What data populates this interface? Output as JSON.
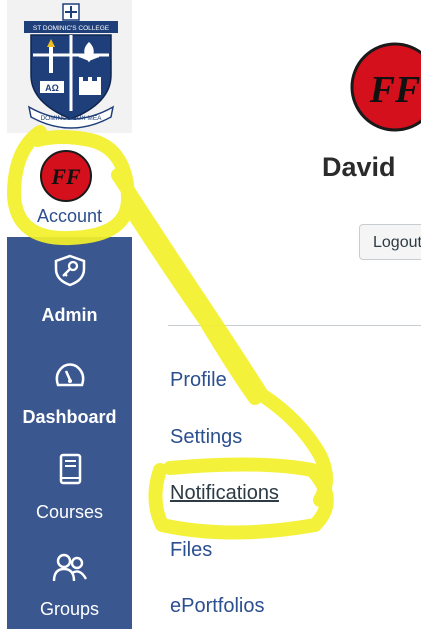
{
  "school": {
    "name": "ST DOMINIC'S COLLEGE",
    "motto": "DOMINUS LUX MEA",
    "initials": "AΩ"
  },
  "user": {
    "name": "David",
    "avatar_initials": "FF"
  },
  "sidebar": {
    "items": [
      {
        "label": "Account",
        "icon": "avatar-icon"
      },
      {
        "label": "Admin",
        "icon": "shield-key-icon"
      },
      {
        "label": "Dashboard",
        "icon": "speedometer-icon"
      },
      {
        "label": "Courses",
        "icon": "book-icon"
      },
      {
        "label": "Groups",
        "icon": "people-icon"
      }
    ]
  },
  "main": {
    "logout_label": "Logout"
  },
  "account_menu": {
    "items": [
      {
        "label": "Profile"
      },
      {
        "label": "Settings"
      },
      {
        "label": "Notifications",
        "active": true
      },
      {
        "label": "Files"
      },
      {
        "label": "ePortfolios"
      }
    ]
  },
  "colors": {
    "sidebar_blue": "#3a5790",
    "link_blue": "#2c4f8f",
    "avatar_red": "#d3101c",
    "highlight_yellow": "#f4f02a"
  }
}
